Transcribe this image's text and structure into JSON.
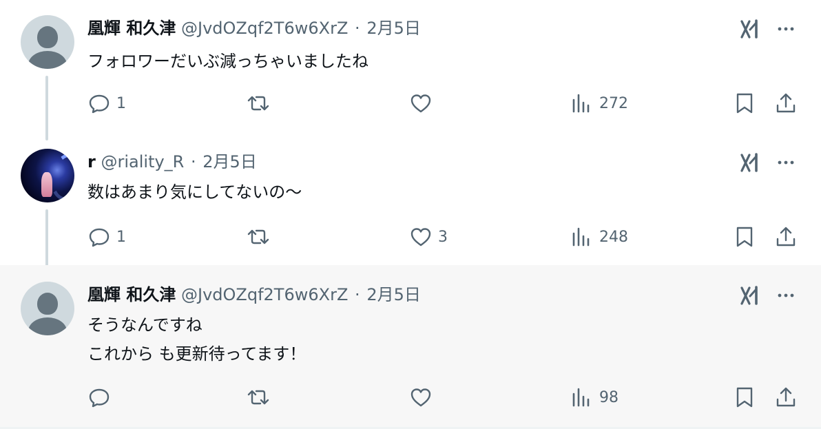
{
  "tweets": [
    {
      "name": "凰輝 和久津",
      "handle": "@JvdOZqf2T6w6XrZ",
      "sep": "·",
      "date": "2月5日",
      "text": "フォロワーだいぶ減っちゃいましたね",
      "reply_count": "1",
      "retweet_count": "",
      "like_count": "",
      "view_count": "272"
    },
    {
      "name": "r",
      "handle": "@riality_R",
      "sep": "·",
      "date": "2月5日",
      "text": "数はあまり気にしてないの〜",
      "reply_count": "1",
      "retweet_count": "",
      "like_count": "3",
      "view_count": "248"
    },
    {
      "name": "凰輝 和久津",
      "handle": "@JvdOZqf2T6w6XrZ",
      "sep": "·",
      "date": "2月5日",
      "text": "そうなんですね\nこれから も更新待ってます！",
      "reply_count": "",
      "retweet_count": "",
      "like_count": "",
      "view_count": "98"
    }
  ],
  "icons": {
    "reply": "reply-icon",
    "retweet": "retweet-icon",
    "like": "heart-icon",
    "views": "views-icon",
    "bookmark": "bookmark-icon",
    "share": "share-icon",
    "grok": "grok-icon",
    "more": "more-icon"
  },
  "colors": {
    "text": "#0f1419",
    "secondary": "#536471",
    "highlight_bg": "#f7f7f7",
    "thread_line": "#cfd9de"
  }
}
